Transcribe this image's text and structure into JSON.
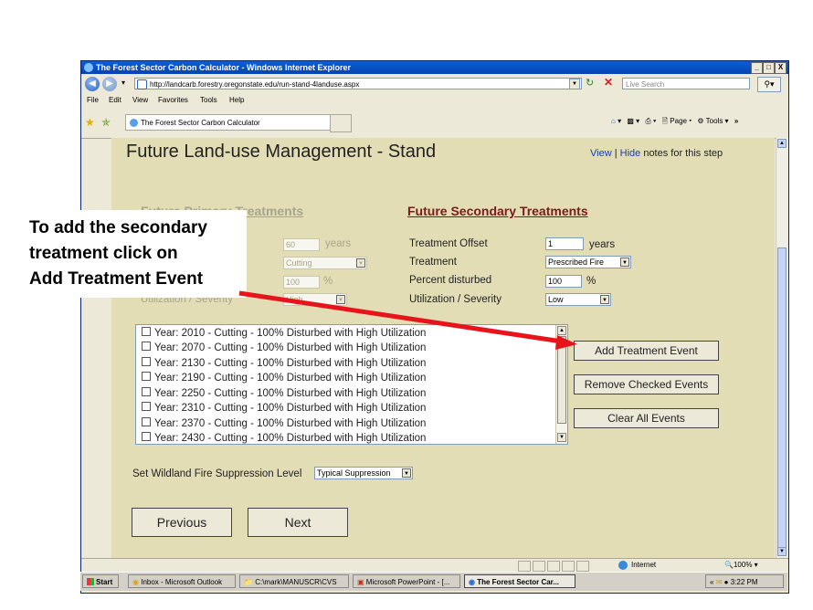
{
  "window": {
    "title": "The Forest Sector Carbon Calculator - Windows Internet Explorer",
    "controls": [
      "_",
      "□",
      "X"
    ]
  },
  "address": {
    "url": "http://landcarb.forestry.oregonstate.edu/run-stand-4landuse.aspx",
    "search_placeholder": "Live Search"
  },
  "menu": [
    "File",
    "Edit",
    "View",
    "Favorites",
    "Tools",
    "Help"
  ],
  "tab": {
    "label": "The Forest Sector Carbon Calculator"
  },
  "commandbar": {
    "page_label": "Page",
    "tools_label": "Tools"
  },
  "page": {
    "title": "Future Land-use Management - Stand",
    "notes": {
      "view": "View",
      "separator": " | ",
      "hide": "Hide",
      "suffix": " notes for this step"
    },
    "primary": {
      "heading": "Future Primary Treatments",
      "offset_value": "60",
      "offset_unit": "years",
      "treatment_value": "Cutting",
      "percent_value": "100",
      "percent_unit": "%",
      "severity_label": "Utilization / Severity",
      "severity_value": "High"
    },
    "secondary": {
      "heading": "Future Secondary Treatments",
      "offset_label": "Treatment Offset",
      "offset_value": "1",
      "offset_unit": "years",
      "treatment_label": "Treatment",
      "treatment_value": "Prescribed Fire",
      "percent_label": "Percent disturbed",
      "percent_value": "100",
      "percent_unit": "%",
      "severity_label": "Utilization / Severity",
      "severity_value": "Low"
    },
    "events": [
      "Year: 2010 - Cutting - 100% Disturbed with High Utilization",
      "Year: 2070 - Cutting - 100% Disturbed with High Utilization",
      "Year: 2130 - Cutting - 100% Disturbed with High Utilization",
      "Year: 2190 - Cutting - 100% Disturbed with High Utilization",
      "Year: 2250 - Cutting - 100% Disturbed with High Utilization",
      "Year: 2310 - Cutting - 100% Disturbed with High Utilization",
      "Year: 2370 - Cutting - 100% Disturbed with High Utilization",
      "Year: 2430 - Cutting - 100% Disturbed with High Utilization"
    ],
    "buttons": {
      "add": "Add Treatment Event",
      "remove": "Remove Checked Events",
      "clear": "Clear All Events",
      "previous": "Previous",
      "next": "Next"
    },
    "suppression": {
      "label": "Set Wildland Fire Suppression Level",
      "value": "Typical Suppression"
    }
  },
  "status": {
    "zone": "Internet",
    "zoom": "100%"
  },
  "taskbar": {
    "start": "Start",
    "items": [
      "Inbox - Microsoft Outlook",
      "C:\\mark\\MANUSCR\\CVS",
      "Microsoft PowerPoint - [...",
      "The Forest Sector Car..."
    ],
    "clock": "3:22 PM"
  },
  "callout": {
    "lines": [
      "To add the secondary",
      "treatment click on",
      "Add Treatment Event"
    ],
    "arrow_color": "#e8141b"
  }
}
